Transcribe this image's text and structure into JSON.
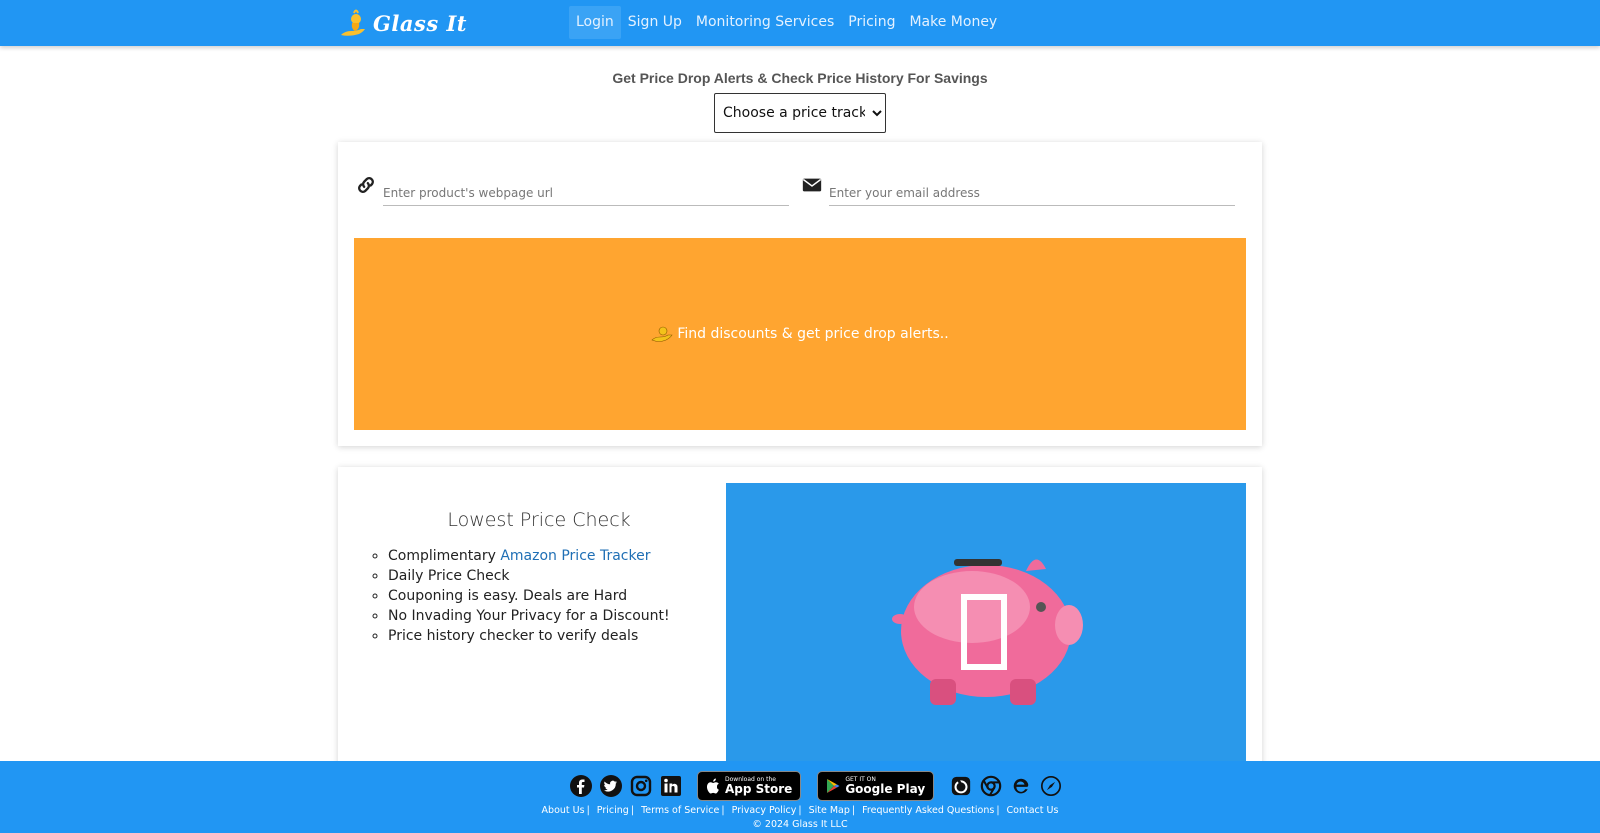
{
  "brand": {
    "name": "Glass It"
  },
  "nav": [
    {
      "label": "Login",
      "active": true
    },
    {
      "label": "Sign Up"
    },
    {
      "label": "Monitoring Services"
    },
    {
      "label": "Pricing"
    },
    {
      "label": "Make Money"
    }
  ],
  "headline": "Get Price Drop Alerts & Check Price History For Savings",
  "tracker_select": {
    "selected": "Choose a price tracker"
  },
  "form": {
    "url_placeholder": "Enter product's webpage url",
    "email_placeholder": "Enter your email address",
    "url_icon": "link-icon",
    "email_icon": "envelope-icon",
    "submit_label": "Find discounts & get price drop alerts.."
  },
  "info": {
    "title": "Lowest Price Check",
    "features": [
      {
        "prefix": "Complimentary ",
        "link": "Amazon Price Tracker"
      },
      {
        "prefix": "Daily Price Check"
      },
      {
        "prefix": "Couponing is easy. Deals are Hard"
      },
      {
        "prefix": "No Invading Your Privacy for a Discount!"
      },
      {
        "prefix": "Price history checker to verify deals"
      }
    ],
    "hero_icon": "piggy-bank-icon"
  },
  "footer": {
    "social_icons": [
      "facebook-icon",
      "twitter-icon",
      "instagram-icon",
      "linkedin-icon"
    ],
    "app_store": {
      "small": "Download on the",
      "big": "App Store"
    },
    "google_play": {
      "small": "GET IT ON",
      "big": "Google Play"
    },
    "browser_icons": [
      "firefox-icon",
      "chrome-icon",
      "edge-icon",
      "safari-icon"
    ],
    "links": [
      "About Us",
      "Pricing",
      "Terms of Service",
      "Privacy Policy",
      "Site Map",
      "Frequently Asked Questions",
      "Contact Us"
    ],
    "copyright": "© 2024 Glass It LLC"
  },
  "colors": {
    "primary": "#2196f3",
    "accent": "#ffa530",
    "hero": "#2a99ea",
    "link": "#1f6fb5"
  }
}
